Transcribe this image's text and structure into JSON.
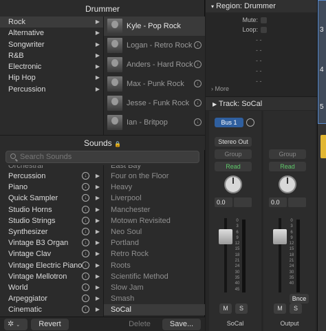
{
  "library": {
    "drummer_title": "Drummer",
    "genres": [
      {
        "label": "Rock",
        "selected": true
      },
      {
        "label": "Alternative"
      },
      {
        "label": "Songwriter"
      },
      {
        "label": "R&B"
      },
      {
        "label": "Electronic"
      },
      {
        "label": "Hip Hop"
      },
      {
        "label": "Percussion"
      }
    ],
    "drummers": [
      {
        "name": "Kyle - Pop Rock",
        "selected": true
      },
      {
        "name": "Logan - Retro Rock"
      },
      {
        "name": "Anders - Hard Rock"
      },
      {
        "name": "Max - Punk Rock"
      },
      {
        "name": "Jesse - Funk Rock"
      },
      {
        "name": "Ian - Britpop"
      }
    ],
    "sounds_title": "Sounds",
    "lock_icon": "🔒",
    "search_placeholder": "Search Sounds",
    "categories": [
      "Percussion",
      "Piano",
      "Quick Sampler",
      "Studio Horns",
      "Studio Strings",
      "Synthesizer",
      "Vintage B3 Organ",
      "Vintage Clav",
      "Vintage Electric Piano",
      "Vintage Mellotron",
      "World",
      "Arpeggiator",
      "Cinematic"
    ],
    "patches": [
      "Four on the Floor",
      "Heavy",
      "Liverpool",
      "Manchester",
      "Motown Revisited",
      "Neo Soul",
      "Portland",
      "Retro Rock",
      "Roots",
      "Scientific Method",
      "Slow Jam",
      "Smash",
      "SoCal"
    ],
    "selected_patch": "SoCal",
    "revert_label": "Revert",
    "delete_label": "Delete",
    "save_label": "Save..."
  },
  "inspector": {
    "region_header": "Region: Drummer",
    "mute_label": "Mute:",
    "loop_label": "Loop:",
    "dash": "-  -",
    "more_label": "More",
    "track_header": "Track: SoCal",
    "strips": [
      {
        "name": "SoCal",
        "send": "Bus 1",
        "output": "Stereo Out",
        "group": "Group",
        "automation": "Read",
        "pan_value": "0.0",
        "mute": "M",
        "solo": "S"
      },
      {
        "name": "Output",
        "group": "Group",
        "automation": "Read",
        "pan_value": "0.0",
        "mute": "M",
        "solo": "S",
        "bounce": "Bnce"
      }
    ],
    "fader_scale": [
      "0",
      "3",
      "6",
      "9",
      "12",
      "15",
      "18",
      "21",
      "24",
      "30",
      "35",
      "40",
      "45",
      "50",
      "60"
    ]
  },
  "track_numbers": [
    "3",
    "4",
    "5"
  ]
}
